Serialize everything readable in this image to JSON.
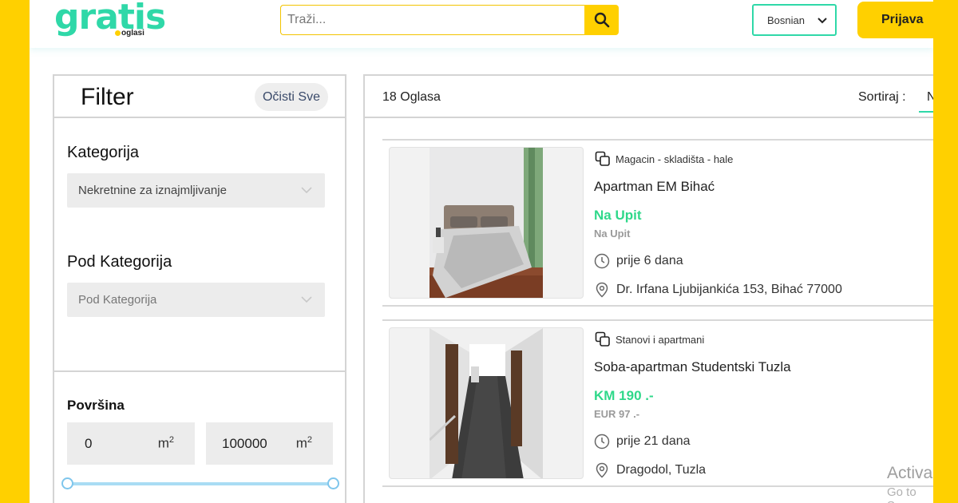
{
  "header": {
    "logo_word": "gratis",
    "logo_sub": "oglasi",
    "search_placeholder": "Traži...",
    "language": "Bosnian",
    "login_label": "Prijava"
  },
  "filter": {
    "title": "Filter",
    "clear_label": "Očisti Sve",
    "category_label": "Kategorija",
    "category_value": "Nekretnine za iznajmljivanje",
    "subcategory_label": "Pod Kategorija",
    "subcategory_value": "Pod Kategorija",
    "area_label": "Površina",
    "area_min": "0",
    "area_max": "100000",
    "area_unit": "m",
    "area_unit_exp": "2",
    "slider_min_fraction": 0,
    "slider_max_fraction": 1
  },
  "results": {
    "count_label": "18 Oglasa",
    "sort_label": "Sortiraj :",
    "sort_value": "N",
    "listings": [
      {
        "category": "Magacin - skladišta - hale",
        "title": "Apartman EM Bihać",
        "price": "Na Upit",
        "price_secondary": "Na Upit",
        "posted": "prije 6 dana",
        "location": "Dr. Irfana Ljubijankića 153, Bihać 77000"
      },
      {
        "category": "Stanovi i apartmani",
        "title": "Soba-apartman Studentski Tuzla",
        "price": "KM 190 .-",
        "price_secondary": "EUR 97 .-",
        "posted": "prije 21 dana",
        "location": "Dragodol, Tuzla"
      }
    ]
  },
  "watermark": {
    "line1": "Activa",
    "line2": "Go to Se"
  },
  "colors": {
    "brand_yellow": "#ffd000",
    "brand_green": "#2fd8a8",
    "price_green": "#2fd88a"
  }
}
